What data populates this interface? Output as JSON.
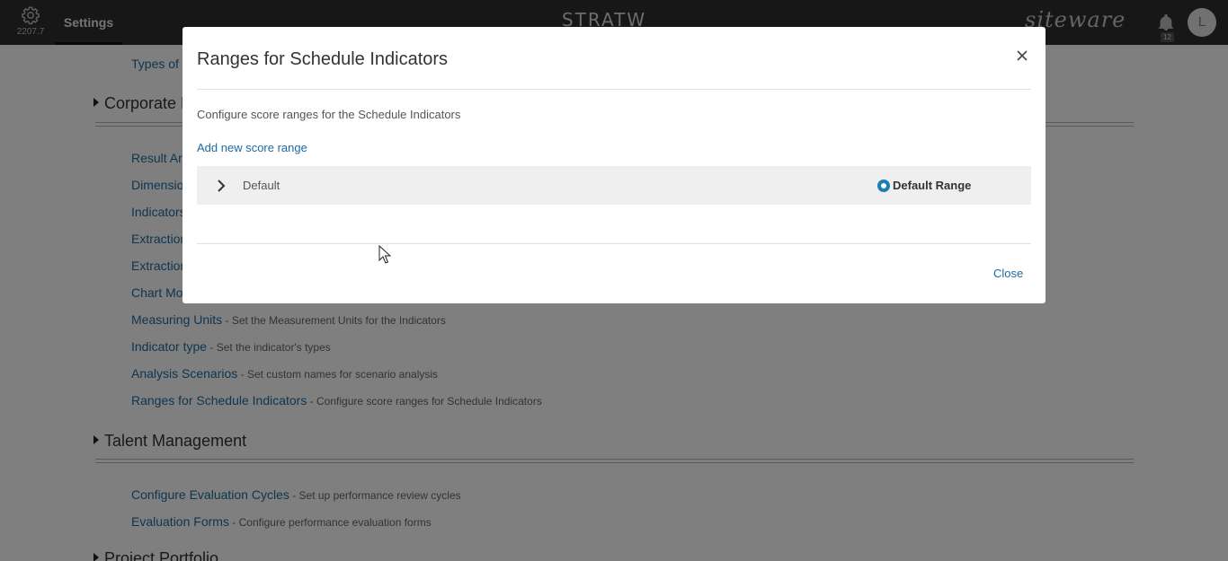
{
  "topbar": {
    "version": "2207.7",
    "settings_tab": "Settings",
    "logo_center": "STRATW",
    "logo_right": "siteware",
    "notification_count": "12",
    "avatar_initial": "L"
  },
  "background": {
    "items_top": [
      {
        "label": "Types of "
      }
    ],
    "sections": [
      {
        "title": "Corporate P"
      },
      {
        "title": "Talent Management"
      },
      {
        "title": "Project Portfolio"
      }
    ],
    "corporate_items": [
      {
        "label": "Result Ar",
        "desc": ""
      },
      {
        "label": "Dimensio",
        "desc": ""
      },
      {
        "label": "Indicators",
        "desc": ""
      },
      {
        "label": "Extraction",
        "desc": ""
      },
      {
        "label": "Extraction",
        "desc": ""
      },
      {
        "label": "Chart Mo",
        "desc": ""
      },
      {
        "label": "Measuring Units",
        "desc": " - Set the Measurement Units for the Indicators"
      },
      {
        "label": "Indicator type",
        "desc": " - Set the indicator's types"
      },
      {
        "label": "Analysis Scenarios",
        "desc": " - Set custom names for scenario analysis"
      },
      {
        "label": "Ranges for Schedule Indicators",
        "desc": " - Configure score ranges for Schedule Indicators"
      }
    ],
    "talent_items": [
      {
        "label": "Configure Evaluation Cycles",
        "desc": " - Set up performance review cycles"
      },
      {
        "label": "Evaluation Forms",
        "desc": " - Configure performance evaluation forms"
      }
    ]
  },
  "modal": {
    "title": "Ranges for Schedule Indicators",
    "description": "Configure score ranges for the Schedule Indicators",
    "add_link": "Add new score range",
    "ranges": [
      {
        "name": "Default",
        "radio_label": "Default Range",
        "selected": true
      }
    ],
    "close_label": "Close"
  },
  "colors": {
    "topbar": "#2f2f2f",
    "link": "#1e6aa0",
    "radio": "#1a7fb2"
  }
}
